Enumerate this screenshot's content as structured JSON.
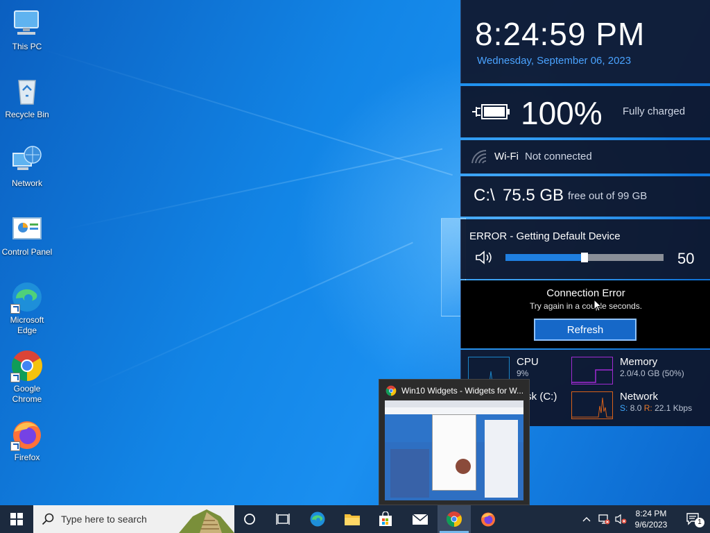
{
  "desktop": {
    "icons": [
      {
        "label": "This PC"
      },
      {
        "label": "Recycle Bin"
      },
      {
        "label": "Network"
      },
      {
        "label": "Control Panel"
      },
      {
        "label": "Microsoft Edge"
      },
      {
        "label": "Google Chrome"
      },
      {
        "label": "Firefox"
      }
    ]
  },
  "widgets": {
    "clock": {
      "time": "8:24:59 PM",
      "date": "Wednesday, September 06, 2023"
    },
    "battery": {
      "percent": "100%",
      "status": "Fully charged"
    },
    "wifi": {
      "label": "Wi-Fi",
      "status": "Not connected"
    },
    "disk": {
      "drive": "C:\\",
      "free": "75.5 GB",
      "total": "free out of 99 GB"
    },
    "volume": {
      "error": "ERROR - Getting Default Device",
      "level": 50,
      "value": "50"
    },
    "connection": {
      "title": "Connection Error",
      "subtitle": "Try again in a couple seconds.",
      "refresh_label": "Refresh"
    },
    "perf": {
      "cpu": {
        "name": "CPU",
        "value": "9%"
      },
      "memory": {
        "name": "Memory",
        "value": "2.0/4.0 GB (50%)"
      },
      "disk": {
        "name": "Disk (C:)"
      },
      "network": {
        "name": "Network",
        "s_label": "S:",
        "s_value": "8.0",
        "r_label": "R:",
        "r_value": "22.1 Kbps"
      }
    }
  },
  "preview": {
    "title": "Win10 Widgets - Widgets for W..."
  },
  "taskbar": {
    "search_placeholder": "Type here to search",
    "time": "8:24 PM",
    "date": "9/6/2023",
    "notification_count": "1"
  },
  "colors": {
    "accent": "#4aa3ff",
    "cpu_graph": "#1b86c9",
    "mem_graph": "#a12bd3",
    "net_graph": "#d9621a",
    "s_color": "#3fa9ff",
    "r_color": "#e8782a"
  }
}
